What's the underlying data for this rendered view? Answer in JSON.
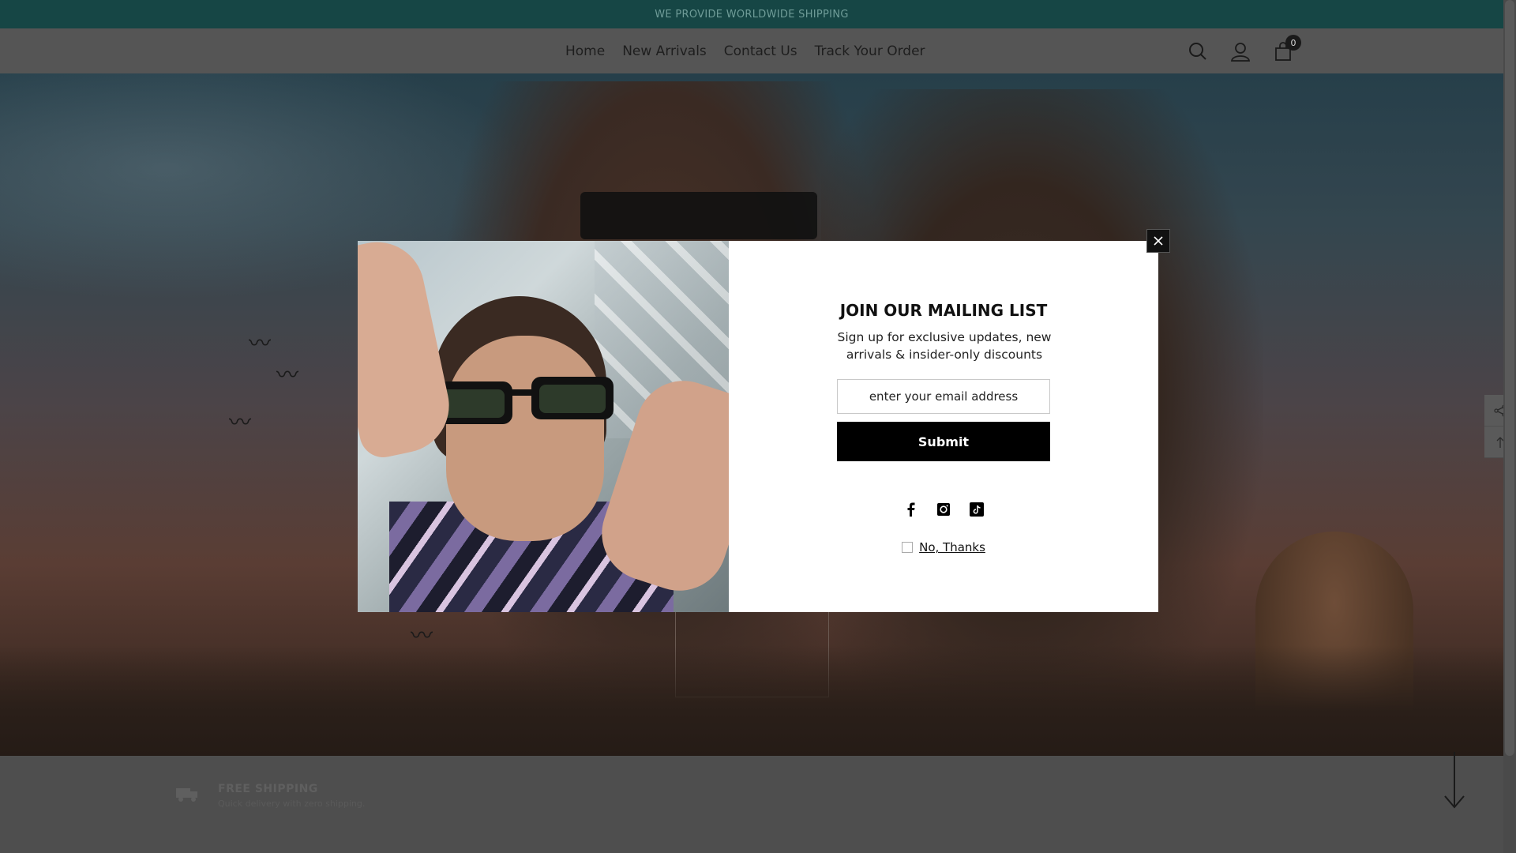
{
  "announcement": {
    "text": "WE PROVIDE WORLDWIDE SHIPPING"
  },
  "nav": {
    "items": [
      {
        "label": "Home"
      },
      {
        "label": "New Arrivals"
      },
      {
        "label": "Contact Us"
      },
      {
        "label": "Track Your Order"
      }
    ]
  },
  "header_icons": {
    "search": "search-icon",
    "account": "user-icon",
    "cart": "cart-icon",
    "cart_count": "0"
  },
  "features": [
    {
      "title": "FREE SHIPPING",
      "subtitle": "Quick delivery with zero shipping."
    }
  ],
  "modal": {
    "title": "JOIN OUR MAILING LIST",
    "subtitle": "Sign up for exclusive updates, new arrivals & insider-only discounts",
    "email_placeholder": "enter your email address",
    "submit_label": "Submit",
    "socials": [
      "facebook-icon",
      "instagram-icon",
      "tiktok-icon"
    ],
    "no_thanks_label": "No, Thanks"
  },
  "colors": {
    "announcement_bg": "#164645",
    "button_bg": "#000000",
    "modal_bg": "#ffffff"
  }
}
